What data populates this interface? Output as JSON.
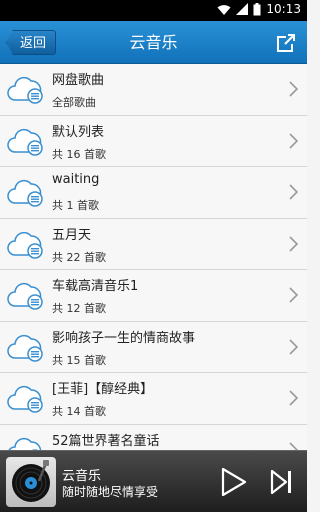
{
  "status_bar": {
    "time": "10:13"
  },
  "header": {
    "back_label": "返回",
    "title": "云音乐"
  },
  "playlists": [
    {
      "title": "网盘歌曲",
      "subtitle": "全部歌曲"
    },
    {
      "title": "默认列表",
      "subtitle": "共 16 首歌"
    },
    {
      "title": "waiting",
      "subtitle": "共 1 首歌"
    },
    {
      "title": "五月天",
      "subtitle": "共 22 首歌"
    },
    {
      "title": "车载高清音乐1",
      "subtitle": "共 12 首歌"
    },
    {
      "title": "影响孩子一生的情商故事",
      "subtitle": "共 15 首歌"
    },
    {
      "title": "[王菲]【醇经典】",
      "subtitle": "共 14 首歌"
    },
    {
      "title": "52篇世界著名童话",
      "subtitle": ""
    }
  ],
  "player": {
    "title": "云音乐",
    "subtitle": "随时随地尽情享受"
  },
  "colors": {
    "accent": "#1a7fc6",
    "icon_blue": "#3a8fd0"
  }
}
